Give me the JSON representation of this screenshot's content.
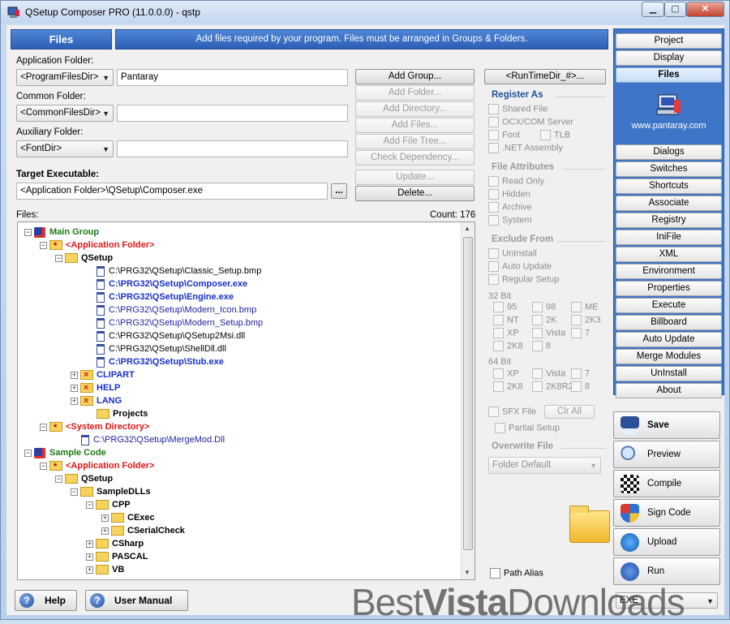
{
  "window": {
    "title": "QSetup Composer PRO (11.0.0.0) - qstp",
    "min": "▁",
    "max": "▢",
    "close": "✕"
  },
  "header": {
    "section": "Files",
    "description": "Add files required by your program.  Files must be arranged in Groups & Folders."
  },
  "folders": {
    "app_label": "Application Folder:",
    "app_combo": "<ProgramFilesDir>",
    "app_value": "Pantaray",
    "common_label": "Common Folder:",
    "common_combo": "<CommonFilesDir>",
    "common_value": "",
    "aux_label": "Auxiliary Folder:",
    "aux_combo": "<FontDir>",
    "aux_value": ""
  },
  "actions": {
    "add_group": "Add Group...",
    "add_folder": "Add Folder...",
    "add_directory": "Add Directory...",
    "add_files": "Add Files...",
    "add_file_tree": "Add File Tree...",
    "check_dependency": "Check Dependency...",
    "update": "Update...",
    "delete": "Delete...",
    "runtime_dir": "<RunTimeDir_#>..."
  },
  "target": {
    "label": "Target Executable:",
    "value": "<Application Folder>\\QSetup\\Composer.exe",
    "browse": "..."
  },
  "files": {
    "label": "Files:",
    "count": "Count: 176",
    "tree": [
      {
        "text": "Main Group",
        "cls": "tg",
        "icon": "group",
        "pm": "−",
        "indent": 0
      },
      {
        "text": "<Application Folder>",
        "cls": "tr",
        "icon": "folder-star",
        "pm": "−",
        "indent": 1
      },
      {
        "text": "QSetup",
        "cls": "tn",
        "icon": "folder",
        "pm": "−",
        "indent": 2
      },
      {
        "text": "C:\\PRG32\\QSetup\\Classic_Setup.bmp",
        "cls": "tk",
        "icon": "doc",
        "pm": "",
        "indent": 4
      },
      {
        "text": "C:\\PRG32\\QSetup\\Composer.exe",
        "cls": "tb",
        "icon": "doc",
        "pm": "",
        "indent": 4
      },
      {
        "text": "C:\\PRG32\\QSetup\\Engine.exe",
        "cls": "tb",
        "icon": "doc",
        "pm": "",
        "indent": 4
      },
      {
        "text": "C:\\PRG32\\QSetup\\Modern_Icon.bmp",
        "cls": "tf",
        "icon": "doc",
        "pm": "",
        "indent": 4
      },
      {
        "text": "C:\\PRG32\\QSetup\\Modern_Setup.bmp",
        "cls": "tf",
        "icon": "doc",
        "pm": "",
        "indent": 4
      },
      {
        "text": "C:\\PRG32\\QSetup\\QSetup2Msi.dll",
        "cls": "tk",
        "icon": "doc",
        "pm": "",
        "indent": 4
      },
      {
        "text": "C:\\PRG32\\QSetup\\ShellDll.dll",
        "cls": "tk",
        "icon": "doc",
        "pm": "",
        "indent": 4
      },
      {
        "text": "C:\\PRG32\\QSetup\\Stub.exe",
        "cls": "tb",
        "icon": "doc",
        "pm": "",
        "indent": 4
      },
      {
        "text": "CLIPART",
        "cls": "tb",
        "icon": "folder-x",
        "pm": "+",
        "indent": 3
      },
      {
        "text": "HELP",
        "cls": "tb",
        "icon": "folder-x",
        "pm": "+",
        "indent": 3
      },
      {
        "text": "LANG",
        "cls": "tb",
        "icon": "folder-x",
        "pm": "+",
        "indent": 3
      },
      {
        "text": "Projects",
        "cls": "tn",
        "icon": "folder",
        "pm": "",
        "indent": 4
      },
      {
        "text": "<System Directory>",
        "cls": "tr",
        "icon": "folder-star",
        "pm": "−",
        "indent": 1
      },
      {
        "text": "C:\\PRG32\\QSetup\\MergeMod.Dll",
        "cls": "tf",
        "icon": "doc",
        "pm": "",
        "indent": 3
      },
      {
        "text": "Sample Code",
        "cls": "tg",
        "icon": "group",
        "pm": "−",
        "indent": 0
      },
      {
        "text": "<Application Folder>",
        "cls": "tr",
        "icon": "folder-star",
        "pm": "−",
        "indent": 1
      },
      {
        "text": "QSetup",
        "cls": "tn",
        "icon": "folder",
        "pm": "−",
        "indent": 2
      },
      {
        "text": "SampleDLLs",
        "cls": "tn",
        "icon": "folder",
        "pm": "−",
        "indent": 3
      },
      {
        "text": "CPP",
        "cls": "tn",
        "icon": "folder",
        "pm": "−",
        "indent": 4
      },
      {
        "text": "CExec",
        "cls": "tn",
        "icon": "folder",
        "pm": "+",
        "indent": 5
      },
      {
        "text": "CSerialCheck",
        "cls": "tn",
        "icon": "folder",
        "pm": "+",
        "indent": 5
      },
      {
        "text": "CSharp",
        "cls": "tn",
        "icon": "folder",
        "pm": "+",
        "indent": 4
      },
      {
        "text": "PASCAL",
        "cls": "tn",
        "icon": "folder",
        "pm": "+",
        "indent": 4
      },
      {
        "text": "VB",
        "cls": "tn",
        "icon": "folder",
        "pm": "+",
        "indent": 4
      }
    ]
  },
  "register_as": {
    "title": "Register As",
    "shared_file": "Shared File",
    "ocx_com": "OCX/COM Server",
    "font": "Font",
    "tlb": "TLB",
    "net_assembly": ".NET Assembly"
  },
  "attributes": {
    "title": "File Attributes",
    "read_only": "Read Only",
    "hidden": "Hidden",
    "archive": "Archive",
    "system": "System"
  },
  "exclude": {
    "title": "Exclude From",
    "uninstall": "UnInstall",
    "auto_update": "Auto Update",
    "regular_setup": "Regular Setup",
    "bit32_label": "32 Bit",
    "bit32": [
      "95",
      "98",
      "ME",
      "NT",
      "2K",
      "2K3",
      "XP",
      "Vista",
      "7",
      "2K8",
      "8"
    ],
    "bit64_label": "64 Bit",
    "bit64": [
      "XP",
      "Vista",
      "7",
      "2K8",
      "2K8R2",
      "8"
    ]
  },
  "sfx": {
    "sfx_file": "SFX File",
    "clr_all": "Clr All",
    "partial_setup": "Partial Setup"
  },
  "overwrite": {
    "title": "Overwrite File",
    "value": "Folder Default"
  },
  "path_alias": "Path Alias",
  "nav": {
    "items": [
      "Project",
      "Display",
      "Files",
      "Dialogs",
      "Switches",
      "Shortcuts",
      "Associate",
      "Registry",
      "IniFile",
      "XML",
      "Environment",
      "Properties",
      "Execute",
      "Billboard",
      "Auto Update",
      "Merge Modules",
      "UnInstall",
      "About"
    ],
    "selected": "Files",
    "logo_text": "www.pantaray.com"
  },
  "tools": {
    "save": "Save",
    "preview": "Preview",
    "compile": "Compile",
    "sign_code": "Sign Code",
    "upload": "Upload",
    "run": "Run",
    "exe_combo": "EXE"
  },
  "footer": {
    "help": "Help",
    "user_manual": "User Manual"
  },
  "watermark": {
    "a": "Best",
    "b": "Vista",
    "c": "Downloads"
  }
}
